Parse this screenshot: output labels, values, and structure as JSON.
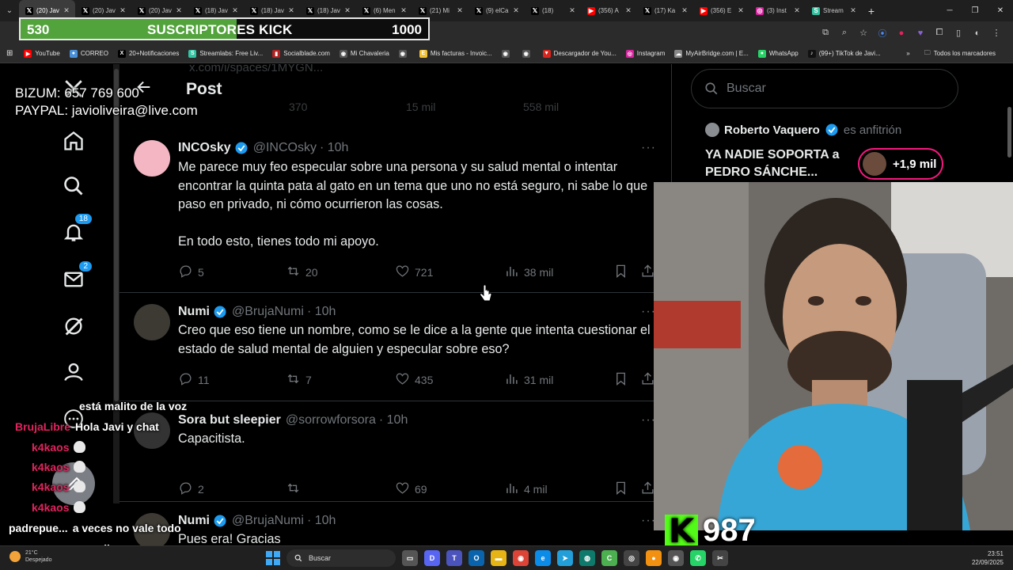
{
  "browser": {
    "tabs": [
      {
        "label": "(20) Jav",
        "icon": "x-logo-icon",
        "color": "#000000",
        "active": true
      },
      {
        "label": "(20) Jav",
        "icon": "x-logo-icon",
        "color": "#000000"
      },
      {
        "label": "(20) Jav",
        "icon": "x-logo-icon",
        "color": "#000000"
      },
      {
        "label": "(18) Jav",
        "icon": "x-logo-icon",
        "color": "#000000"
      },
      {
        "label": "(18) Jav",
        "icon": "x-logo-icon",
        "color": "#000000"
      },
      {
        "label": "(18) Jav",
        "icon": "x-logo-icon",
        "color": "#000000"
      },
      {
        "label": "(6) Men",
        "icon": "x-logo-icon",
        "color": "#000000"
      },
      {
        "label": "(21) Mi",
        "icon": "x-logo-icon",
        "color": "#000000"
      },
      {
        "label": "(9) elCa",
        "icon": "x-logo-icon",
        "color": "#000000"
      },
      {
        "label": "(18)",
        "icon": "x-logo-icon",
        "color": "#000000"
      },
      {
        "label": "(356) A",
        "icon": "youtube-icon",
        "color": "#ff0000"
      },
      {
        "label": "(17) Ka",
        "icon": "x-logo-icon",
        "color": "#000000"
      },
      {
        "label": "(356) E",
        "icon": "youtube-icon",
        "color": "#ff0000"
      },
      {
        "label": "(3) Inst",
        "icon": "instagram-icon",
        "color": "#d6249f"
      },
      {
        "label": "Stream",
        "icon": "streamlabs-icon",
        "color": "#31c3a2"
      }
    ],
    "bookmarks": [
      {
        "label": "YouTube",
        "color": "#ff0000",
        "glyph": "▶"
      },
      {
        "label": "CORREO",
        "color": "#4a90d9",
        "glyph": "●"
      },
      {
        "label": "20+Notificaciones",
        "color": "#000000",
        "glyph": "X"
      },
      {
        "label": "Streamlabs: Free Liv...",
        "color": "#31c3a2",
        "glyph": "S"
      },
      {
        "label": "Socialblade.com",
        "color": "#b22222",
        "glyph": "▮"
      },
      {
        "label": "Mi Chavaleria",
        "color": "#555555",
        "glyph": "◉"
      },
      {
        "label": "",
        "color": "#555555",
        "glyph": "◉"
      },
      {
        "label": "Mis facturas - Invoic...",
        "color": "#f2c230",
        "glyph": "E"
      },
      {
        "label": "",
        "color": "#555555",
        "glyph": "◉"
      },
      {
        "label": "",
        "color": "#555555",
        "glyph": "◉"
      },
      {
        "label": "Descargador de You...",
        "color": "#d9251d",
        "glyph": "▼"
      },
      {
        "label": "Instagram",
        "color": "#d6249f",
        "glyph": "◎"
      },
      {
        "label": "MyAirBridge.com | E...",
        "color": "#888888",
        "glyph": "☁"
      },
      {
        "label": "WhatsApp",
        "color": "#25d366",
        "glyph": "●"
      },
      {
        "label": "(99+) TikTok de Javi...",
        "color": "#111111",
        "glyph": "♪"
      }
    ],
    "bookmarks_folder": "Todos los marcadores"
  },
  "overlay": {
    "kick_goal": {
      "current": "530",
      "label": "SUSCRIPTORES KICK",
      "target": "1000",
      "progress": 0.53
    },
    "donations_bizum": "BIZUM: 657 769 600",
    "donations_paypal": "PAYPAL: javioliveira@live.com",
    "kick_viewers": "987",
    "chat": [
      {
        "user": "",
        "message": "está malito de la voz",
        "user_color": "#ffffff"
      },
      {
        "user": "BrujaLibre",
        "message": "Hola Javi y chat",
        "user_color": "#e0245e"
      },
      {
        "user": "k4kaos",
        "message": "",
        "user_color": "#e0245e"
      },
      {
        "user": "k4kaos",
        "message": "",
        "user_color": "#e0245e"
      },
      {
        "user": "k4kaos",
        "message": "",
        "user_color": "#e0245e"
      },
      {
        "user": "k4kaos",
        "message": "",
        "user_color": "#e0245e"
      },
      {
        "user": "padrepue...",
        "message": "a veces no vale todo",
        "user_color": "#ffffff"
      },
      {
        "user": "",
        "message": "por dinero..",
        "user_color": "#ffffff"
      }
    ]
  },
  "twitter": {
    "header_title": "Post",
    "ghost_url": "x.com/i/spaces/1MYGN...",
    "ghost_actions": {
      "retweets": "370",
      "likes": "15 mil",
      "views": "558 mil"
    },
    "nav": {
      "notifications_badge": "18",
      "messages_badge": "2"
    },
    "tweets": [
      {
        "name": "INCOsky",
        "handle": "@INCOsky",
        "time": "· 10h",
        "text": "Me parece muy feo especular sobre una persona y su salud mental o intentar encontrar la quinta pata al gato en un tema que uno no está seguro, ni sabe lo que paso en privado, ni cómo ocurrieron las cosas.\n\nEn todo esto, tienes todo mi apoyo.",
        "replies": "5",
        "retweets": "20",
        "likes": "721",
        "views": "38 mil"
      },
      {
        "name": "Numi",
        "handle": "@BrujaNumi",
        "time": "· 10h",
        "text": "Creo que eso tiene un nombre, como se le dice a la gente que intenta cuestionar el estado de salud mental de alguien y especular sobre eso?",
        "replies": "11",
        "retweets": "7",
        "likes": "435",
        "views": "31 mil"
      },
      {
        "name": "Sora but sleepier",
        "handle": "@sorrowforsora",
        "time": "· 10h",
        "text": "Capacitista.",
        "replies": "2",
        "retweets": "",
        "likes": "69",
        "views": "4 mil"
      },
      {
        "name": "Numi",
        "handle": "@BrujaNumi",
        "time": "· 10h",
        "text": "Pues era! Gracias",
        "replies": "",
        "retweets": "",
        "likes": "",
        "views": ""
      }
    ],
    "search_placeholder": "Buscar",
    "space": {
      "host": "Roberto Vaquero",
      "role": "es anfitrión",
      "title": "YA NADIE SOPORTA a PEDRO SÁNCHE...",
      "listeners": "+1,9 mil"
    }
  },
  "taskbar": {
    "weather_temp": "21°C",
    "weather_desc": "Despejado",
    "search_placeholder": "Buscar",
    "time": "23:51",
    "date": "22/09/2025"
  },
  "colors": {
    "accent": "#1d9bf0",
    "kick_green": "#53a33d",
    "kick_brand": "#53fc18",
    "live_pink": "#f91880"
  }
}
